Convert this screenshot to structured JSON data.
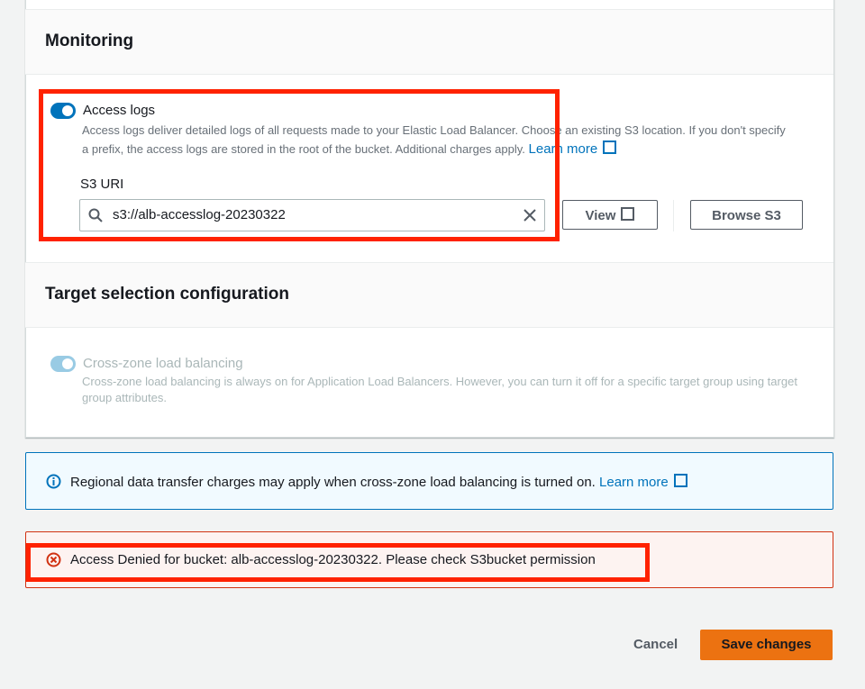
{
  "monitoring": {
    "title": "Monitoring",
    "access_logs": {
      "label": "Access logs",
      "enabled": true,
      "description": "Access logs deliver detailed logs of all requests made to your Elastic Load Balancer. Choose an existing S3 location. If you don't specify a prefix, the access logs are stored in the root of the bucket. Additional charges apply.",
      "learn_more": "Learn more",
      "s3_uri_label": "S3 URI",
      "s3_uri_value": "s3://alb-accesslog-20230322",
      "view_label": "View",
      "browse_label": "Browse S3"
    }
  },
  "target_selection": {
    "title": "Target selection configuration",
    "cross_zone": {
      "label": "Cross-zone load balancing",
      "enabled": true,
      "disabled": true,
      "description": "Cross-zone load balancing is always on for Application Load Balancers. However, you can turn it off for a specific target group using target group attributes."
    }
  },
  "info_alert": {
    "text": "Regional data transfer charges may apply when cross-zone load balancing is turned on.",
    "learn_more": "Learn more"
  },
  "error_alert": {
    "text": "Access Denied for bucket: alb-accesslog-20230322. Please check S3bucket permission"
  },
  "footer": {
    "cancel": "Cancel",
    "save": "Save changes"
  },
  "colors": {
    "accent": "#0073bb",
    "primary_button": "#ec7211",
    "error": "#d13212",
    "highlight": "#ff2200"
  }
}
